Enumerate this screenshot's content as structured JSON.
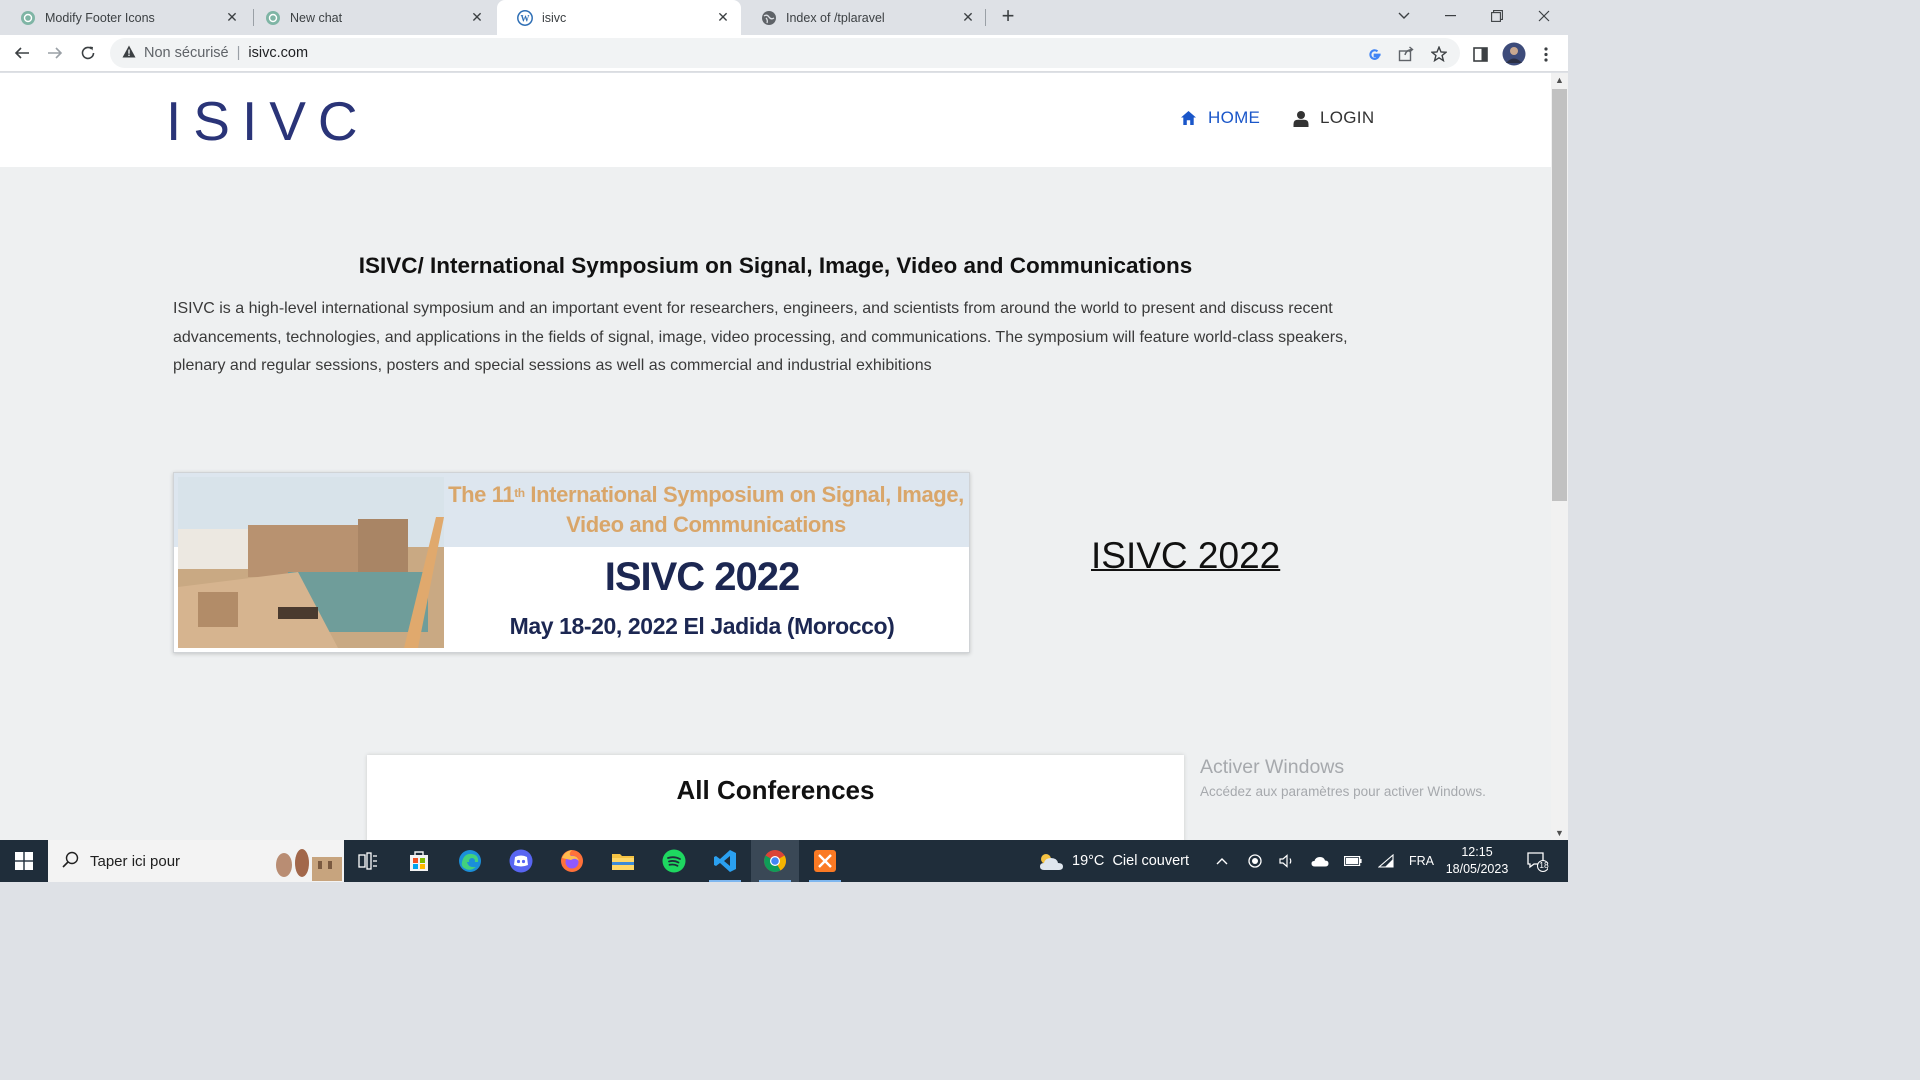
{
  "browser": {
    "tabs": [
      {
        "title": "Modify Footer Icons",
        "icon": "chatgpt-icon",
        "active": false
      },
      {
        "title": "New chat",
        "icon": "chatgpt-icon",
        "active": false
      },
      {
        "title": "isivc",
        "icon": "wordpress-icon",
        "active": true
      },
      {
        "title": "Index of /tplaravel",
        "icon": "globe-icon",
        "active": false
      }
    ],
    "address": {
      "security_label": "Non sécurisé",
      "url": "isivc.com"
    }
  },
  "site": {
    "logo_text": "ISIVC",
    "nav": {
      "home_label": "HOME",
      "login_label": "LOGIN"
    },
    "intro": {
      "title": "ISIVC/ International Symposium on Signal, Image, Video and Communications",
      "text": "ISIVC is a high-level international symposium and an important event for researchers, engineers, and scientists from around the world to present and discuss recent advancements, technologies, and applications in the fields of signal, image, video processing, and communications. The symposium will feature world-class speakers, plenary and regular sessions, posters and special sessions as well as commercial and industrial exhibitions"
    },
    "banner": {
      "headline_prefix": "The 11",
      "headline_sup": "th",
      "headline_rest": " International Symposium on Signal, Image, Video and Communications",
      "event": "ISIVC 2022",
      "date_place": "May 18-20, 2022 El Jadida (Morocco)"
    },
    "side_link": "ISIVC 2022",
    "conferences_title": "All Conferences"
  },
  "watermark": {
    "line1": "Activer Windows",
    "line2": "Accédez aux paramètres pour activer Windows."
  },
  "taskbar": {
    "search_placeholder": "Taper ici pour",
    "weather": "19°C  Ciel couvert",
    "language": "FRA",
    "time": "12:15",
    "date": "18/05/2023",
    "notification_count": "18"
  },
  "colors": {
    "accent_nav": "#1a56c9",
    "logo": "#2a3478",
    "banner_gold": "#d9a66a",
    "banner_navy": "#1c2752",
    "taskbar": "#1f2d3a"
  }
}
